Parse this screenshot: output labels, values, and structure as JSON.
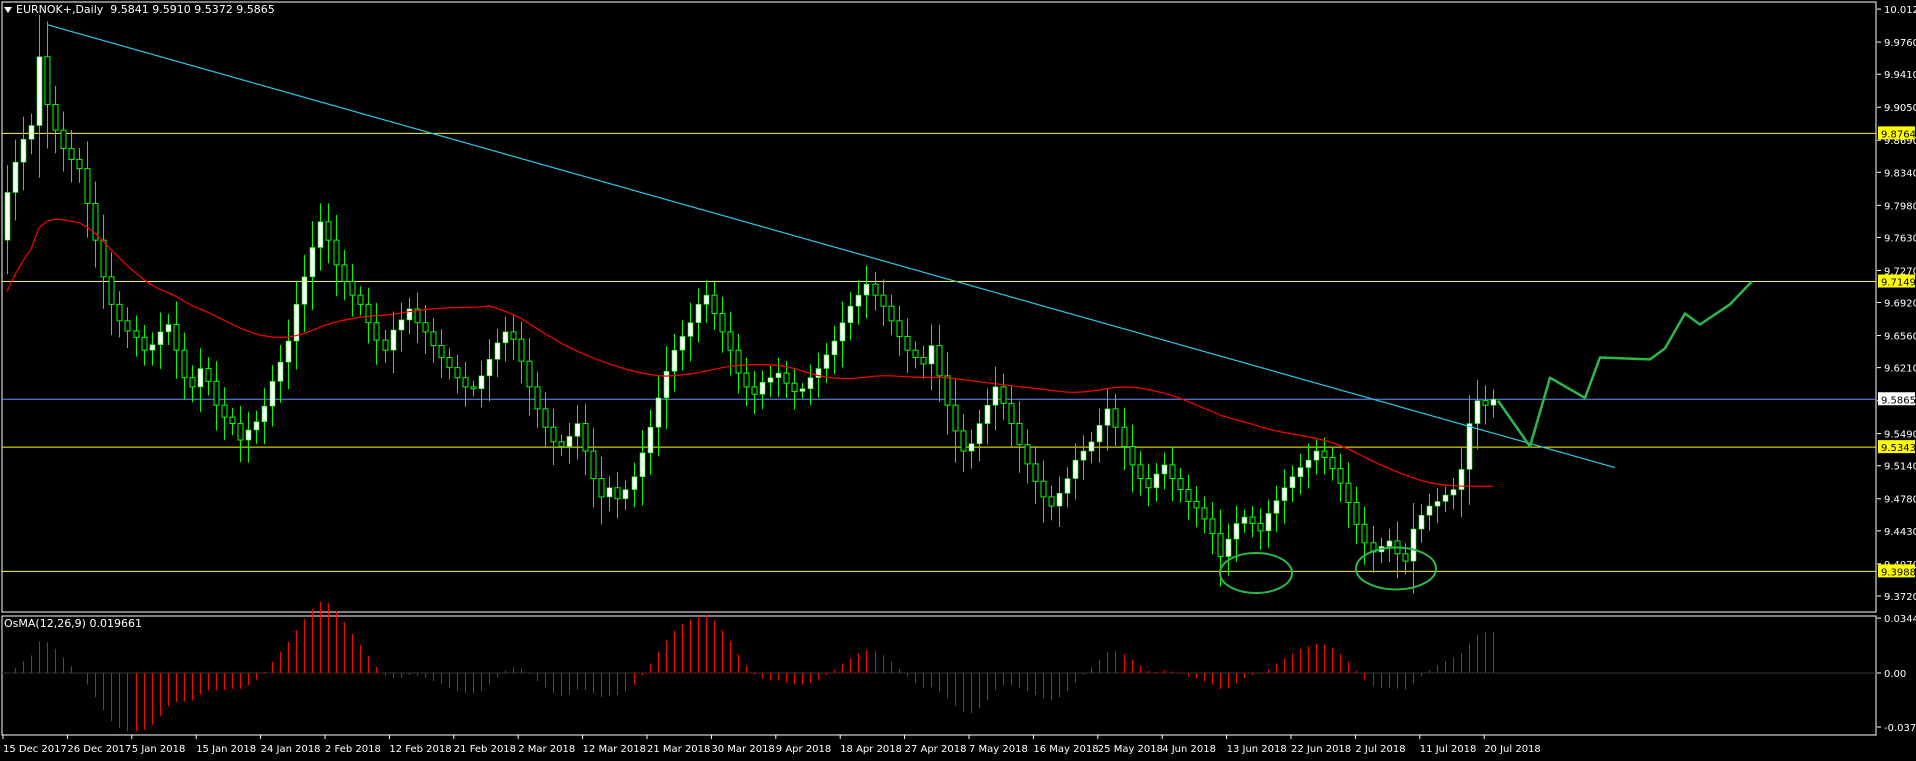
{
  "header": {
    "symbol": "EURNOK+,Daily",
    "ohlc": "9.5841 9.5910 9.5372 9.5865"
  },
  "indicator": {
    "label": "OsMA(12,26,9) 0.019661"
  },
  "colors": {
    "background": "#000000",
    "bull_candle": "#ffffff",
    "wick_and_bear": "#00ff00",
    "horizontal_levels": "#ffff00",
    "price_label_bg": "#ffff00",
    "current_price_line": "#6b8fff",
    "trendline": "#2fc8e6",
    "moving_average": "#ff0000",
    "forecast_drawing": "#2bb84a",
    "osma_bars": "#ff0000"
  },
  "chart_data": {
    "type": "candlestick",
    "y_axis": {
      "min": 9.3545,
      "max": 10.0197,
      "tick_labels": [
        "10.0120",
        "9.9760",
        "9.9410",
        "9.9050",
        "9.8690",
        "9.8340",
        "9.7980",
        "9.7630",
        "9.7270",
        "9.6920",
        "9.6560",
        "9.6210",
        "9.5850",
        "9.5490",
        "9.5140",
        "9.4780",
        "9.4430",
        "9.4070",
        "9.3720"
      ]
    },
    "x_axis": {
      "tick_labels": [
        "15 Dec 2017",
        "26 Dec 2017",
        "5 Jan 2018",
        "15 Jan 2018",
        "24 Jan 2018",
        "2 Feb 2018",
        "12 Feb 2018",
        "21 Feb 2018",
        "2 Mar 2018",
        "12 Mar 2018",
        "21 Mar 2018",
        "30 Mar 2018",
        "9 Apr 2018",
        "18 Apr 2018",
        "27 Apr 2018",
        "7 May 2018",
        "16 May 2018",
        "25 May 2018",
        "4 Jun 2018",
        "13 Jun 2018",
        "22 Jun 2018",
        "2 Jul 2018",
        "11 Jul 2018",
        "20 Jul 2018"
      ]
    },
    "horizontal_levels": [
      {
        "value": 9.8764,
        "label": "9.8764"
      },
      {
        "value": 9.7149,
        "label": "9.7149"
      },
      {
        "value": 9.5343,
        "label": "9.5343"
      },
      {
        "value": 9.3988,
        "label": "9.3988"
      }
    ],
    "current_price": {
      "value": 9.5865,
      "label": "9.5865"
    },
    "closes": [
      9.812,
      9.845,
      9.87,
      9.885,
      9.96,
      9.908,
      9.88,
      9.86,
      9.848,
      9.838,
      9.8,
      9.76,
      9.72,
      9.69,
      9.672,
      9.661,
      9.654,
      9.64,
      9.646,
      9.66,
      9.668,
      9.64,
      9.61,
      9.6,
      9.62,
      9.606,
      9.58,
      9.567,
      9.56,
      9.542,
      9.553,
      9.562,
      9.579,
      9.606,
      9.627,
      9.65,
      9.69,
      9.72,
      9.752,
      9.78,
      9.76,
      9.733,
      9.715,
      9.7,
      9.69,
      9.67,
      9.651,
      9.64,
      9.662,
      9.673,
      9.685,
      9.67,
      9.66,
      9.645,
      9.632,
      9.621,
      9.61,
      9.6,
      9.598,
      9.612,
      9.63,
      9.648,
      9.66,
      9.652,
      9.628,
      9.6,
      9.576,
      9.556,
      9.54,
      9.535,
      9.546,
      9.56,
      9.53,
      9.5,
      9.48,
      9.49,
      9.478,
      9.488,
      9.502,
      9.528,
      9.556,
      9.588,
      9.617,
      9.64,
      9.655,
      9.67,
      9.69,
      9.7,
      9.68,
      9.66,
      9.64,
      9.615,
      9.6,
      9.592,
      9.605,
      9.61,
      9.615,
      9.604,
      9.595,
      9.598,
      9.61,
      9.62,
      9.635,
      9.65,
      9.67,
      9.688,
      9.7,
      9.712,
      9.7,
      9.688,
      9.672,
      9.655,
      9.64,
      9.632,
      9.625,
      9.645,
      9.612,
      9.58,
      9.552,
      9.53,
      9.538,
      9.56,
      9.58,
      9.6,
      9.582,
      9.56,
      9.537,
      9.516,
      9.497,
      9.48,
      9.47,
      9.484,
      9.5,
      9.52,
      9.53,
      9.54,
      9.558,
      9.576,
      9.556,
      9.535,
      9.515,
      9.5,
      9.49,
      9.505,
      9.515,
      9.5,
      9.488,
      9.475,
      9.468,
      9.456,
      9.44,
      9.415,
      9.434,
      9.451,
      9.458,
      9.451,
      9.443,
      9.462,
      9.476,
      9.49,
      9.502,
      9.512,
      9.52,
      9.53,
      9.523,
      9.511,
      9.495,
      9.474,
      9.45,
      9.43,
      9.42,
      9.426,
      9.432,
      9.418,
      9.41,
      9.445,
      9.46,
      9.47,
      9.475,
      9.482,
      9.488,
      9.51,
      9.56,
      9.585,
      9.58,
      9.5865
    ]
  }
}
